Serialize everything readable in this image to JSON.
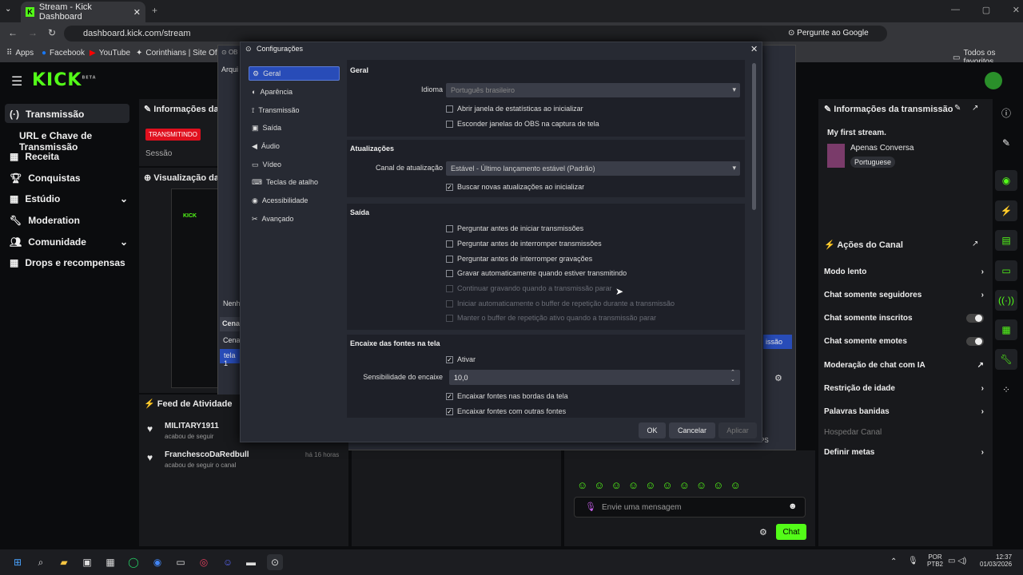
{
  "browser": {
    "tab_title": "Stream - Kick Dashboard",
    "url": "dashboard.kick.com/stream",
    "ask_google": "Pergunte ao Google",
    "all_favorites": "Todos os favoritos",
    "bookmarks": [
      "Apps",
      "Facebook",
      "YouTube",
      "Corinthians | Site Of..."
    ]
  },
  "kick": {
    "logo": "KICK",
    "beta": "BETA"
  },
  "sidebar": [
    "Transmissão",
    "URL e Chave de Transmissão",
    "Receita",
    "Conquistas",
    "Estúdio",
    "Moderation",
    "Comunidade",
    "Drops e recompensas"
  ],
  "stream_info": {
    "title": "Informações da s",
    "badge": "TRANSMITINDO",
    "session": "Sessão",
    "preview_title": "Visualização da T",
    "obs_nenh": "Nenh",
    "obs_cena": "Cena",
    "obs_cena2": "Cena",
    "obs_tela": "tela 1",
    "obs_arqu": "Arqui",
    "obs_ob": "OB"
  },
  "activity": {
    "title": "Feed de Atividade",
    "items": [
      {
        "name": "MILITARY1911",
        "text": "acabou de seguir"
      },
      {
        "name": "FranchescoDaRedbull",
        "text": "acabou de seguir o canal",
        "time": "há 16 horas"
      }
    ]
  },
  "right": {
    "info_title": "Informações da transmissão",
    "stream_name": "My first stream.",
    "category": "Apenas Conversa",
    "language": "Portuguese",
    "actions_title": "Ações do Canal",
    "actions": [
      "Modo lento",
      "Chat somente seguidores",
      "Chat somente inscritos",
      "Chat somente emotes",
      "Moderação de chat com IA",
      "Restrição de idade",
      "Palavras banidas",
      "Hospedar Canal",
      "Definir metas"
    ]
  },
  "chat": {
    "placeholder": "Envie uma mensagem",
    "send": "Chat",
    "fps": "40 FPS",
    "issao": "issão",
    "o": "o"
  },
  "dialog": {
    "title": "Configurações",
    "nav": [
      "Geral",
      "Aparência",
      "Transmissão",
      "Saída",
      "Áudio",
      "Vídeo",
      "Teclas de atalho",
      "Acessibilidade",
      "Avançado"
    ],
    "geral": {
      "header": "Geral",
      "language_label": "Idioma",
      "language_value": "Português brasileiro",
      "checks": [
        "Abrir janela de estatísticas ao inicializar",
        "Esconder janelas do OBS na captura de tela"
      ]
    },
    "updates": {
      "header": "Atualizações",
      "channel_label": "Canal de atualização",
      "channel_value": "Estável - Último lançamento estável (Padrão)",
      "check": "Buscar novas atualizações ao inicializar"
    },
    "output": {
      "header": "Saída",
      "checks": [
        "Perguntar antes de iniciar transmissões",
        "Perguntar antes de interromper transmissões",
        "Perguntar antes de interromper gravações",
        "Gravar automaticamente quando estiver transmitindo",
        "Continuar gravando quando a transmissão parar",
        "Iniciar automaticamente o buffer de repetição durante a transmissão",
        "Manter o buffer de repetição ativo quando a transmissão parar"
      ]
    },
    "snapping": {
      "header": "Encaixe das fontes na tela",
      "enable": "Ativar",
      "sensitivity_label": "Sensibilidade do encaixe",
      "sensitivity_value": "10,0",
      "checks": [
        "Encaixar fontes nas bordas da tela",
        "Encaixar fontes com outras fontes"
      ]
    },
    "buttons": {
      "ok": "OK",
      "cancel": "Cancelar",
      "apply": "Aplicar"
    }
  },
  "taskbar": {
    "lang": "POR",
    "layout": "PTB2",
    "time": "12:37",
    "date": "01/03/2026"
  },
  "colors": {
    "kick_green": "#53fc18",
    "selected": "#284cb8",
    "live_red": "#e0101e"
  }
}
